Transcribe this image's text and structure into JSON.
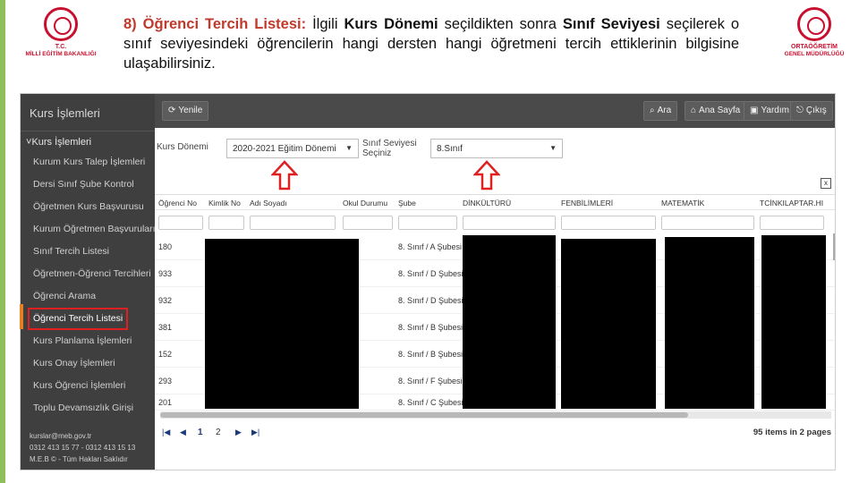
{
  "slide": {
    "logo_left_caption_1": "T.C.",
    "logo_left_caption_2": "MİLLİ EĞİTİM BAKANLIĞI",
    "logo_right_caption_1": "ORTAÖĞRETİM",
    "logo_right_caption_2": "GENEL MÜDÜRLÜĞÜ",
    "step_number": "8)",
    "step_title": "Öğrenci Tercih Listesi:",
    "text_1": " İlgili ",
    "bold_1": "Kurs Dönemi",
    "text_2": " seçildikten sonra ",
    "bold_2": "Sınıf Seviyesi",
    "text_3": " seçilerek o sınıf seviyesindeki öğrencilerin hangi dersten hangi öğretmeni tercih ettiklerinin bilgisine ulaşabilirsiniz."
  },
  "colors": {
    "sidebar_bg": "#3f3f3f",
    "topbar_bg": "#4a4a4a",
    "highlight_red": "#e02020",
    "title_red": "#c0392b",
    "accent_green": "#8fbf5a",
    "accent_orange": "#e67e22"
  },
  "sidebar": {
    "brand": "Kurs İşlemleri",
    "group": "Kurs İşlemleri",
    "items": [
      {
        "label": "Kurum Kurs Talep İşlemleri"
      },
      {
        "label": "Dersi Sınıf Şube Kontrol"
      },
      {
        "label": "Öğretmen Kurs Başvurusu"
      },
      {
        "label": "Kurum Öğretmen Başvuruları"
      },
      {
        "label": "Sınıf Tercih Listesi"
      },
      {
        "label": "Öğretmen-Öğrenci Tercihleri"
      },
      {
        "label": "Öğrenci Arama"
      },
      {
        "label": "Öğrenci Tercih Listesi"
      },
      {
        "label": "Kurs Planlama İşlemleri"
      },
      {
        "label": "Kurs Onay İşlemleri"
      },
      {
        "label": "Kurs Öğrenci İşlemleri"
      },
      {
        "label": "Toplu Devamsızlık Girişi"
      }
    ],
    "footer": {
      "email": "kurslar@meb.gov.tr",
      "phone": "0312 413 15 77 - 0312 413 15 13",
      "copyright": "M.E.B © - Tüm Hakları Saklıdır"
    }
  },
  "toolbar": {
    "refresh": "Yenile",
    "search": "Ara",
    "home": "Ana Sayfa",
    "help": "Yardım",
    "logout": "Çıkış"
  },
  "filters": {
    "term_label": "Kurs Dönemi",
    "term_value": "2020-2021 Eğitim Dönemi",
    "level_label_1": "Sınıf Seviyesi",
    "level_label_2": "Seçiniz",
    "level_value": "8.Sınıf"
  },
  "table": {
    "columns": [
      "Öğrenci No",
      "Kimlik No",
      "Adı Soyadı",
      "Okul Durumu",
      "Şube",
      "DİNKÜLTÜRÜ",
      "FENBİLİMLERİ",
      "MATEMATİK",
      "TCİNKILAPTAR.HI"
    ],
    "rows": [
      {
        "no": "180",
        "sube": "8. Sınıf / A Şubesi"
      },
      {
        "no": "933",
        "sube": "8. Sınıf / D Şubesi"
      },
      {
        "no": "932",
        "sube": "8. Sınıf / D Şubesi"
      },
      {
        "no": "381",
        "sube": "8. Sınıf / B Şubesi"
      },
      {
        "no": "152",
        "sube": "8. Sınıf / B Şubesi"
      },
      {
        "no": "293",
        "sube": "8. Sınıf / F Şubesi"
      },
      {
        "no": "201",
        "sube": "8. Sınıf / C Şubesi"
      }
    ]
  },
  "pager": {
    "page_1": "1",
    "page_2": "2",
    "info": "95 items in 2 pages"
  }
}
